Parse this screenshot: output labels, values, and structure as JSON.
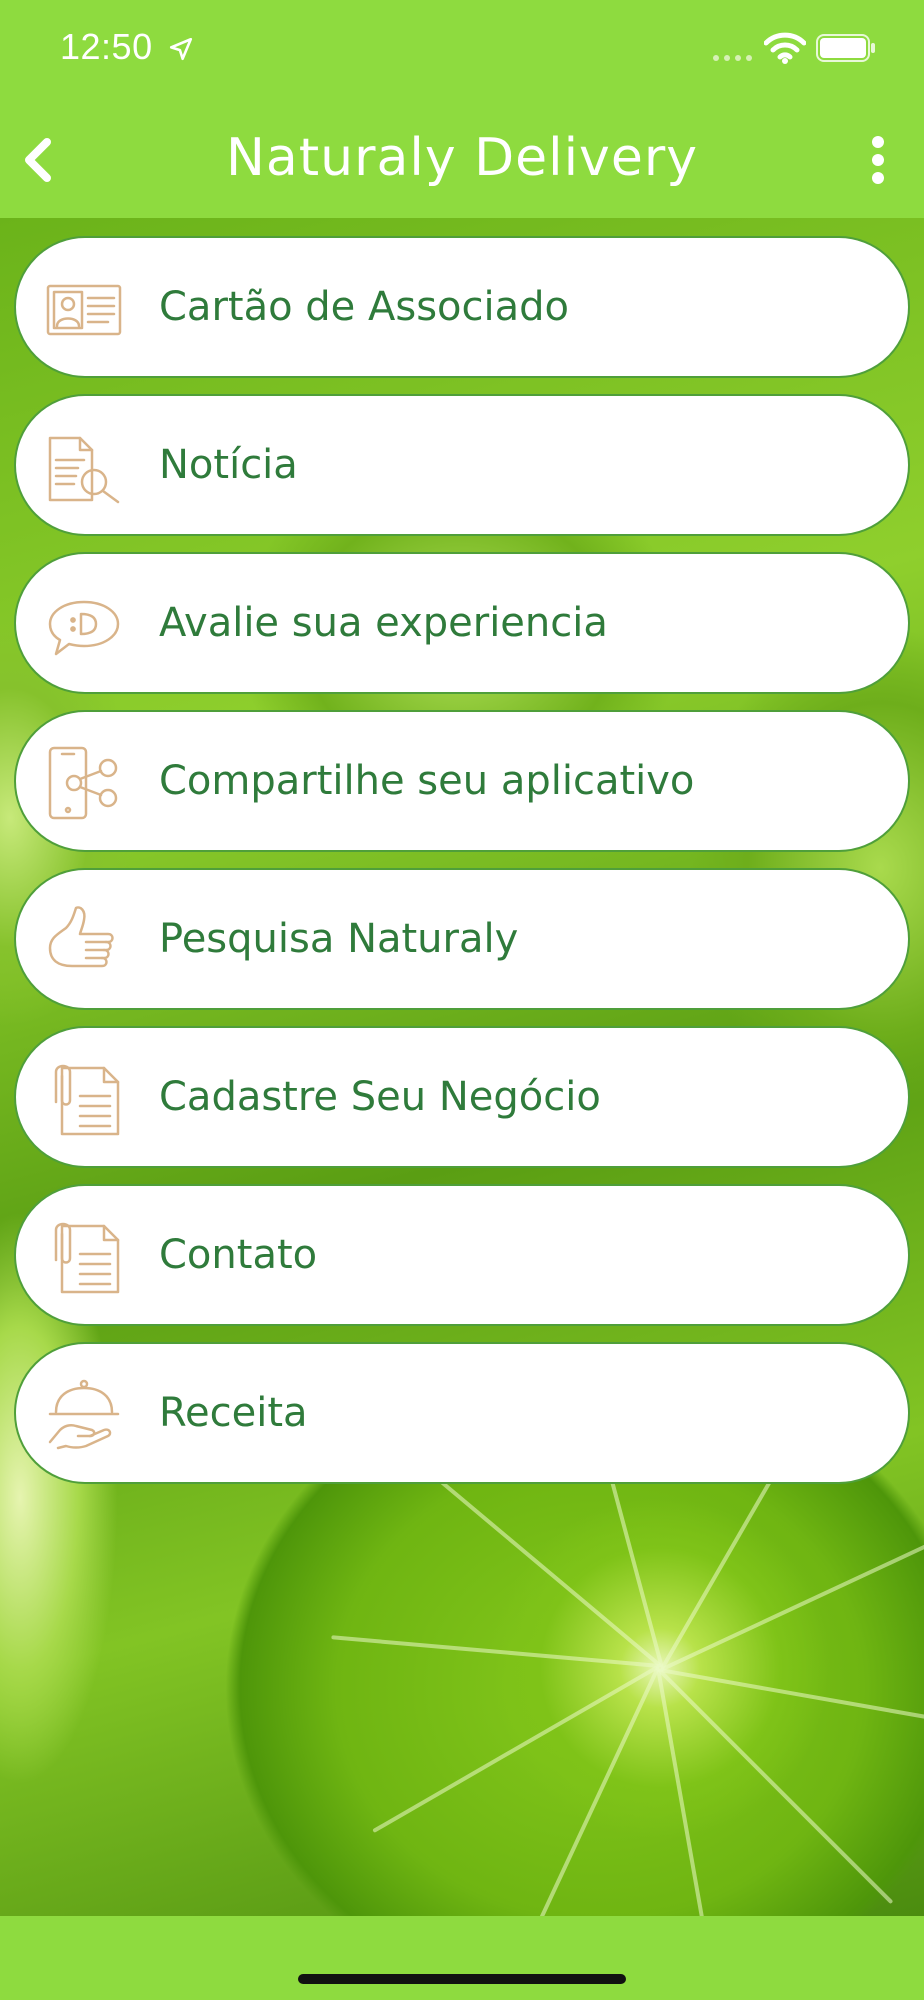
{
  "status_bar": {
    "time": "12:50",
    "icons": [
      "location-arrow-icon",
      "cellular-signal-icon",
      "wifi-icon",
      "battery-icon"
    ]
  },
  "nav": {
    "title": "Naturaly Delivery",
    "back_icon": "chevron-left-icon",
    "more_icon": "more-vertical-icon"
  },
  "menu": {
    "items": [
      {
        "label": "Cartão de Associado",
        "icon": "id-card-icon"
      },
      {
        "label": "Notícia",
        "icon": "document-search-icon"
      },
      {
        "label": "Avalie sua experiencia",
        "icon": "speech-bubble-icon"
      },
      {
        "label": "Compartilhe seu aplicativo",
        "icon": "phone-share-icon"
      },
      {
        "label": "Pesquisa Naturaly",
        "icon": "thumbs-up-icon"
      },
      {
        "label": "Cadastre Seu Negócio",
        "icon": "clipboard-document-icon"
      },
      {
        "label": "Contato",
        "icon": "clipboard-document-icon"
      },
      {
        "label": "Receita",
        "icon": "serving-cloche-icon"
      }
    ]
  },
  "colors": {
    "bar_green": "#8edb3f",
    "label_green": "#2f7b3b",
    "border_green": "#4f9f3a",
    "icon_tan": "#d9b48a",
    "white": "#ffffff"
  }
}
